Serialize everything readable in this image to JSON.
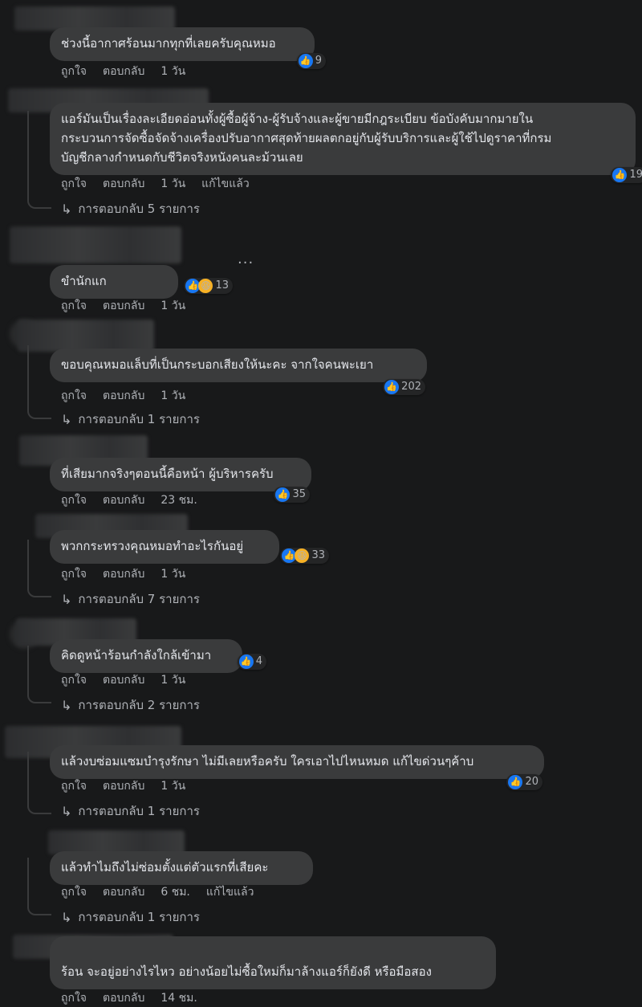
{
  "labels": {
    "like": "ถูกใจ",
    "reply": "ตอบกลับ",
    "edited": "แก้ไขแล้ว",
    "more": "..."
  },
  "comments": [
    {
      "text": "ช่วงนี้อากาศร้อนมากทุกที่เลยครับคุณหมอ",
      "reactions": "9",
      "time": "1 วัน"
    },
    {
      "text": "แอร์มันเป็นเรื่องละเอียดอ่อนทั้งผู้ซื้อผู้จ้าง-ผู้รับจ้างและผู้ขายมีกฎระเบียบ ข้อบังคับมากมายใน\nกระบวนการจัดซื้อจัดจ้างเครื่องปรับอากาศสุดท้ายผลตกอยู่กับผู้รับบริการและผู้ใช้ไปดูราคาที่กรม\nบัญชีกลางกำหนดกับชีวิตจริงหนังคนละม้วนเลย",
      "reactions": "19",
      "time": "1 วัน",
      "replies": "การตอบกลับ 5 รายการ"
    },
    {
      "text": "ขำนักแก",
      "reactions": "13",
      "time": "1 วัน"
    },
    {
      "text": "ขอบคุณหมอแล็บที่เป็นกระบอกเสียงให้นะคะ จากใจคนพะเยา",
      "reactions": "202",
      "time": "1 วัน",
      "replies": "การตอบกลับ 1 รายการ"
    },
    {
      "text": "ที่เสียมากจริงๆตอนนี้คือหน้า ผู้บริหารครับ",
      "reactions": "35",
      "time": "23 ชม."
    },
    {
      "text": "พวกกระทรวงคุณหมอทำอะไรกันอยู่",
      "reactions": "33",
      "time": "1 วัน",
      "replies": "การตอบกลับ 7 รายการ"
    },
    {
      "text": "คิดดูหน้าร้อนกำลังใกล้เข้ามา",
      "reactions": "4",
      "time": "1 วัน",
      "replies": "การตอบกลับ 2 รายการ"
    },
    {
      "text": "แล้วงบซ่อมแซมบำรุงรักษา ไม่มีเลยหรือครับ ใครเอาไปไหนหมด แก้ไขด่วนๆค้าบ",
      "reactions": "20",
      "time": "1 วัน",
      "replies": "การตอบกลับ 1 รายการ"
    },
    {
      "text": "แล้วทำไมถึงไม่ซ่อมตั้งแต่ตัวแรกที่เสียคะ",
      "time": "6 ชม.",
      "replies": "การตอบกลับ 1 รายการ"
    },
    {
      "text": "ร้อน จะอยู่อย่างไรไหว อย่างน้อยไม่ซื้อใหม่ก็มาล้างแอร์ก็ยังดี หรือมือสอง",
      "time": "14 ชม."
    }
  ]
}
